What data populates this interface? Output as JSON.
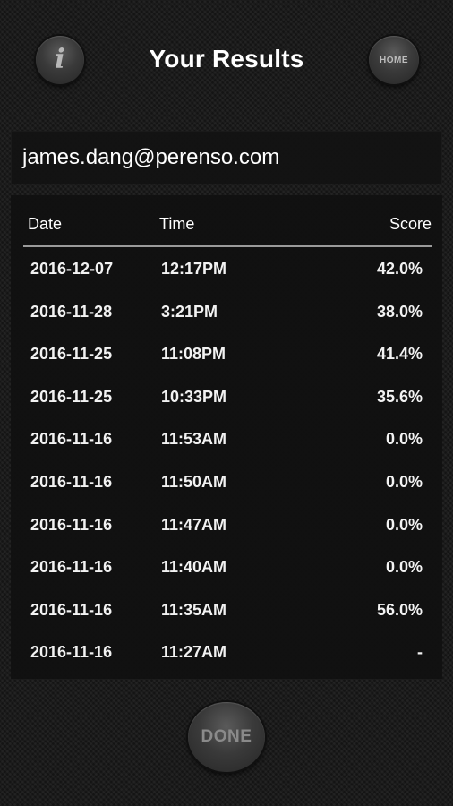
{
  "header": {
    "title": "Your Results",
    "info_icon": "info-icon",
    "info_glyph": "i",
    "home_label": "HOME"
  },
  "user": {
    "email": "james.dang@perenso.com"
  },
  "table": {
    "columns": [
      "Date",
      "Time",
      "Score"
    ],
    "rows": [
      {
        "date": "2016-12-07",
        "time": "12:17PM",
        "score": "42.0%"
      },
      {
        "date": "2016-11-28",
        "time": "3:21PM",
        "score": "38.0%"
      },
      {
        "date": "2016-11-25",
        "time": "11:08PM",
        "score": "41.4%"
      },
      {
        "date": "2016-11-25",
        "time": "10:33PM",
        "score": "35.6%"
      },
      {
        "date": "2016-11-16",
        "time": "11:53AM",
        "score": "0.0%"
      },
      {
        "date": "2016-11-16",
        "time": "11:50AM",
        "score": "0.0%"
      },
      {
        "date": "2016-11-16",
        "time": "11:47AM",
        "score": "0.0%"
      },
      {
        "date": "2016-11-16",
        "time": "11:40AM",
        "score": "0.0%"
      },
      {
        "date": "2016-11-16",
        "time": "11:35AM",
        "score": "56.0%"
      },
      {
        "date": "2016-11-16",
        "time": "11:27AM",
        "score": "-"
      }
    ]
  },
  "footer": {
    "done_label": "DONE"
  }
}
